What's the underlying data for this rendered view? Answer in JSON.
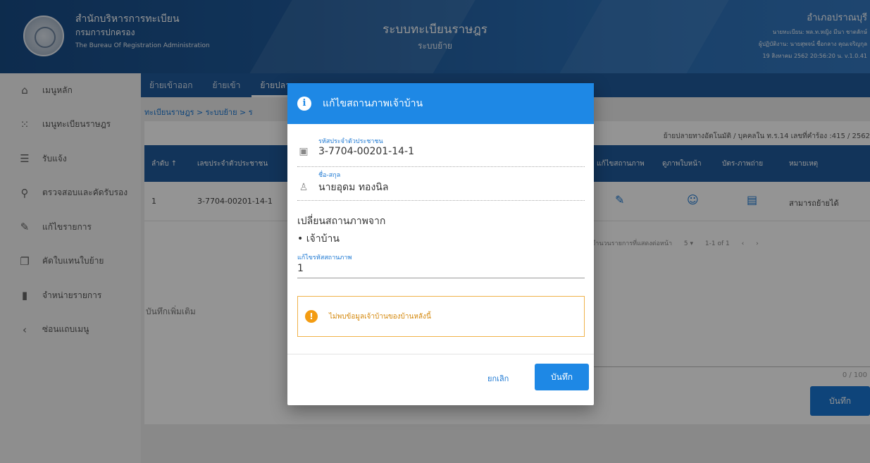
{
  "header": {
    "org_name": "สำนักบริหารการทะเบียน",
    "org_sub": "กรมการปกครอง",
    "org_en": "The Bureau Of Registration Administration",
    "system_title": "ระบบทะเบียนราษฎร",
    "system_sub": "ระบบย้าย",
    "right_title": "อำเภอปราณบุรี",
    "right_line1": "นายทะเบียน: พล.ท.หญิง มีนา ชาตลักษ์",
    "right_line2": "ผู้ปฏิบัติงาน: นายสุพจน์ ชื่อกลาง คุณเจริญกุล",
    "right_line3": "19 สิงหาคม 2562 20:56:20 น.  v.1.0.41"
  },
  "sidebar": {
    "items": [
      {
        "label": "เมนูหลัก",
        "icon": "home-icon"
      },
      {
        "label": "เมนูทะเบียนราษฎร",
        "icon": "grid-icon"
      },
      {
        "label": "รับแจ้ง",
        "icon": "list-icon"
      },
      {
        "label": "ตรวจสอบและคัดรับรอง",
        "icon": "search-icon"
      },
      {
        "label": "แก้ไขรายการ",
        "icon": "edit-icon"
      },
      {
        "label": "คัดใบแทนใบย้าย",
        "icon": "copy-icon"
      },
      {
        "label": "จำหน่ายรายการ",
        "icon": "trash-icon"
      },
      {
        "label": "ซ่อนแถบเมนู",
        "icon": "chevron-left-icon"
      }
    ]
  },
  "tabs": [
    "ย้ายเข้าออก",
    "ย้ายเข้า",
    "ย้ายปลายทาง"
  ],
  "breadcrumb": "ทะเบียนราษฎร  >  ระบบย้าย  >  ร",
  "info_row": "ย้ายปลายทางอัตโนมัติ / บุคคลใน ท.ร.14    เลขที่คำร้อง :415 / 2562",
  "grid": {
    "headers": [
      "ลำดับ ↑",
      "เลขประจำตัวประชาชน",
      "แก้ไขสถานภาพ",
      "ดูภาพใบหน้า",
      "บัตร-ภาพถ่าย",
      "หมายเหตุ"
    ],
    "row": {
      "index": "1",
      "pid": "3-7704-00201-14-1",
      "remark": "สามารถย้ายได้"
    }
  },
  "pager": {
    "per_page_label": "จำนวนรายการที่แสดงต่อหน้า",
    "per_page": "5 ▾",
    "range": "1-1 of 1",
    "prev": "‹",
    "next": "›"
  },
  "notes": {
    "label": "บันทึกเพิ่มเติม",
    "count": "0 / 100",
    "save": "บันทึก"
  },
  "dialog": {
    "title": "แก้ไขสถานภาพเจ้าบ้าน",
    "pid_label": "รหัสประจำตัวประชาชน",
    "pid_value": "3-7704-00201-14-1",
    "name_label": "ชื่อ-สกุล",
    "name_value": "นายอุดม ทองนิล",
    "change_from": "เปลี่ยนสถานภาพจาก",
    "current_status": "เจ้าบ้าน",
    "edit_label": "แก้ไขรหัสสถานภาพ",
    "edit_value": "1",
    "warning": "ไม่พบข้อมูลเจ้าบ้านของบ้านหลังนี้",
    "cancel": "ยกเลิก",
    "save": "บันทึก"
  },
  "colors": {
    "primary": "#1e88e5",
    "header": "#1f5a9b",
    "warning": "#f39c12"
  }
}
